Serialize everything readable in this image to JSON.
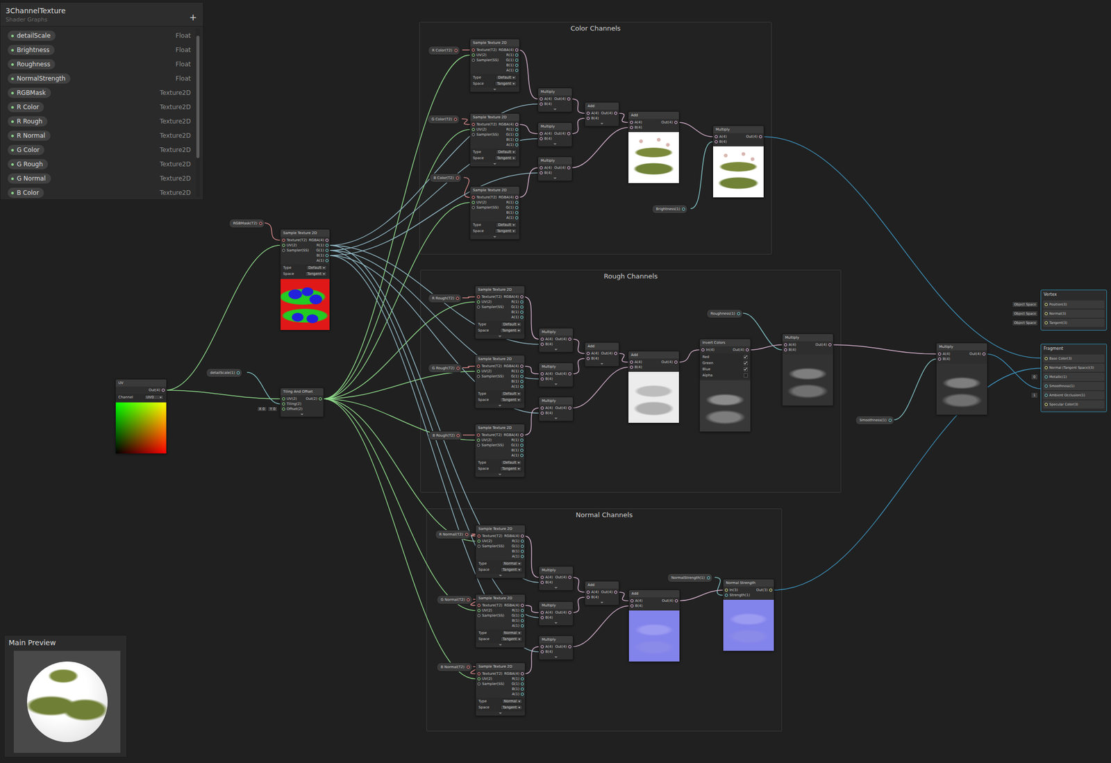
{
  "blackboard": {
    "title": "3ChannelTexture",
    "subtitle": "Shader Graphs",
    "add": "+",
    "properties": [
      {
        "name": "detailScale",
        "type": "Float"
      },
      {
        "name": "Brightness",
        "type": "Float"
      },
      {
        "name": "Roughness",
        "type": "Float"
      },
      {
        "name": "NormalStrength",
        "type": "Float"
      },
      {
        "name": "RGBMask",
        "type": "Texture2D"
      },
      {
        "name": "R Color",
        "type": "Texture2D"
      },
      {
        "name": "R Rough",
        "type": "Texture2D"
      },
      {
        "name": "R Normal",
        "type": "Texture2D"
      },
      {
        "name": "G Color",
        "type": "Texture2D"
      },
      {
        "name": "G Rough",
        "type": "Texture2D"
      },
      {
        "name": "G Normal",
        "type": "Texture2D"
      },
      {
        "name": "B Color",
        "type": "Texture2D"
      }
    ]
  },
  "main_preview": {
    "title": "Main Preview"
  },
  "groups": [
    {
      "title": "Color Channels"
    },
    {
      "title": "Rough Channels"
    },
    {
      "title": "Normal Channels"
    }
  ],
  "chips": [
    {
      "label": "RGBMask(T2)"
    },
    {
      "label": "detailScale(1)"
    },
    {
      "label": "R Color(T2)"
    },
    {
      "label": "G Color(T2)"
    },
    {
      "label": "B Color(T2)"
    },
    {
      "label": "Brightness(1)"
    },
    {
      "label": "R Rough(T2)"
    },
    {
      "label": "G Rough(T2)"
    },
    {
      "label": "B Rough(T2)"
    },
    {
      "label": "Roughness(1)"
    },
    {
      "label": "R Normal(T2)"
    },
    {
      "label": "G Normal(T2)"
    },
    {
      "label": "B Normal(T2)"
    },
    {
      "label": "NormalStrength(1)"
    },
    {
      "label": "Smoothness(1)"
    }
  ],
  "nodes": [
    {
      "title": "UV",
      "inputs": [],
      "outputs": [
        "Out(4)"
      ],
      "settings": [
        {
          "label": "Channel",
          "value": "UV0"
        }
      ],
      "preview": "uv"
    },
    {
      "title": "Sample Texture 2D",
      "inputs": [
        "Texture(T2)",
        "UV(2)",
        "Sampler(SS)"
      ],
      "outputs": [
        "RGBA(4)",
        "R(1)",
        "G(1)",
        "B(1)",
        "A(1)"
      ],
      "settings": [
        {
          "label": "Type",
          "value": "Default"
        },
        {
          "label": "Space",
          "value": "Tangent"
        }
      ],
      "preview": "mask"
    },
    {
      "title": "Tiling And Offset",
      "inputs": [
        "UV(2)",
        "Tiling(2)",
        "Offset(2)"
      ],
      "outputs": [
        "Out(2)"
      ],
      "fields": [
        {
          "axis": "X",
          "value": "0"
        },
        {
          "axis": "Y",
          "value": "0"
        }
      ],
      "preview": "none"
    },
    {
      "title": "Sample Texture 2D",
      "inputs": [
        "Texture(T2)",
        "UV(2)",
        "Sampler(SS)"
      ],
      "outputs": [
        "RGBA(4)",
        "R(1)",
        "G(1)",
        "B(1)",
        "A(1)"
      ],
      "settings": [
        {
          "label": "Type",
          "value": "Default"
        },
        {
          "label": "Space",
          "value": "Tangent"
        }
      ],
      "preview": "none"
    },
    {
      "title": "Sample Texture 2D",
      "inputs": [
        "Texture(T2)",
        "UV(2)",
        "Sampler(SS)"
      ],
      "outputs": [
        "RGBA(4)",
        "R(1)",
        "G(1)",
        "B(1)",
        "A(1)"
      ],
      "settings": [
        {
          "label": "Type",
          "value": "Default"
        },
        {
          "label": "Space",
          "value": "Tangent"
        }
      ],
      "preview": "none"
    },
    {
      "title": "Sample Texture 2D",
      "inputs": [
        "Texture(T2)",
        "UV(2)",
        "Sampler(SS)"
      ],
      "outputs": [
        "RGBA(4)",
        "R(1)",
        "G(1)",
        "B(1)",
        "A(1)"
      ],
      "settings": [
        {
          "label": "Type",
          "value": "Default"
        },
        {
          "label": "Space",
          "value": "Tangent"
        }
      ],
      "preview": "none"
    },
    {
      "title": "Multiply",
      "inputs": [
        "A(4)",
        "B(4)"
      ],
      "outputs": [
        "Out(4)"
      ],
      "preview": "none"
    },
    {
      "title": "Multiply",
      "inputs": [
        "A(4)",
        "B(4)"
      ],
      "outputs": [
        "Out(4)"
      ],
      "preview": "none"
    },
    {
      "title": "Multiply",
      "inputs": [
        "A(4)",
        "B(4)"
      ],
      "outputs": [
        "Out(4)"
      ],
      "preview": "none"
    },
    {
      "title": "Add",
      "inputs": [
        "A(4)",
        "B(4)"
      ],
      "outputs": [
        "Out(4)"
      ],
      "preview": "none"
    },
    {
      "title": "Add",
      "inputs": [
        "A(4)",
        "B(4)"
      ],
      "outputs": [
        "Out(4)"
      ],
      "preview": "color"
    },
    {
      "title": "Multiply",
      "inputs": [
        "A(4)",
        "B(4)"
      ],
      "outputs": [
        "Out(4)"
      ],
      "preview": "color"
    },
    {
      "title": "Sample Texture 2D",
      "inputs": [
        "Texture(T2)",
        "UV(2)",
        "Sampler(SS)"
      ],
      "outputs": [
        "RGBA(4)",
        "R(1)",
        "G(1)",
        "B(1)",
        "A(1)"
      ],
      "settings": [
        {
          "label": "Type",
          "value": "Default"
        },
        {
          "label": "Space",
          "value": "Tangent"
        }
      ],
      "preview": "none"
    },
    {
      "title": "Sample Texture 2D",
      "inputs": [
        "Texture(T2)",
        "UV(2)",
        "Sampler(SS)"
      ],
      "outputs": [
        "RGBA(4)",
        "R(1)",
        "G(1)",
        "B(1)",
        "A(1)"
      ],
      "settings": [
        {
          "label": "Type",
          "value": "Default"
        },
        {
          "label": "Space",
          "value": "Tangent"
        }
      ],
      "preview": "none"
    },
    {
      "title": "Sample Texture 2D",
      "inputs": [
        "Texture(T2)",
        "UV(2)",
        "Sampler(SS)"
      ],
      "outputs": [
        "RGBA(4)",
        "R(1)",
        "G(1)",
        "B(1)",
        "A(1)"
      ],
      "settings": [
        {
          "label": "Type",
          "value": "Default"
        },
        {
          "label": "Space",
          "value": "Tangent"
        }
      ],
      "preview": "none"
    },
    {
      "title": "Multiply",
      "inputs": [
        "A(4)",
        "B(4)"
      ],
      "outputs": [
        "Out(4)"
      ],
      "preview": "none"
    },
    {
      "title": "Multiply",
      "inputs": [
        "A(4)",
        "B(4)"
      ],
      "outputs": [
        "Out(4)"
      ],
      "preview": "none"
    },
    {
      "title": "Multiply",
      "inputs": [
        "A(4)",
        "B(4)"
      ],
      "outputs": [
        "Out(4)"
      ],
      "preview": "none"
    },
    {
      "title": "Add",
      "inputs": [
        "A(4)",
        "B(4)"
      ],
      "outputs": [
        "Out(4)"
      ],
      "preview": "none"
    },
    {
      "title": "Add",
      "inputs": [
        "A(4)",
        "B(4)"
      ],
      "outputs": [
        "Out(4)"
      ],
      "preview": "rough"
    },
    {
      "title": "Invert Colors",
      "inputs": [
        "In(4)"
      ],
      "outputs": [
        "Out(4)"
      ],
      "toggles": [
        {
          "label": "Red",
          "checked": true
        },
        {
          "label": "Green",
          "checked": true
        },
        {
          "label": "Blue",
          "checked": true
        },
        {
          "label": "Alpha",
          "checked": false
        }
      ],
      "preview": "invert"
    },
    {
      "title": "Multiply",
      "inputs": [
        "A(4)",
        "B(4)"
      ],
      "outputs": [
        "Out(4)"
      ],
      "preview": "dark"
    },
    {
      "title": "Sample Texture 2D",
      "inputs": [
        "Texture(T2)",
        "UV(2)",
        "Sampler(SS)"
      ],
      "outputs": [
        "RGBA(4)",
        "R(1)",
        "G(1)",
        "B(1)",
        "A(1)"
      ],
      "settings": [
        {
          "label": "Type",
          "value": "Normal"
        },
        {
          "label": "Space",
          "value": "Tangent"
        }
      ],
      "preview": "none"
    },
    {
      "title": "Sample Texture 2D",
      "inputs": [
        "Texture(T2)",
        "UV(2)",
        "Sampler(SS)"
      ],
      "outputs": [
        "RGBA(4)",
        "R(1)",
        "G(1)",
        "B(1)",
        "A(1)"
      ],
      "settings": [
        {
          "label": "Type",
          "value": "Normal"
        },
        {
          "label": "Space",
          "value": "Tangent"
        }
      ],
      "preview": "none"
    },
    {
      "title": "Sample Texture 2D",
      "inputs": [
        "Texture(T2)",
        "UV(2)",
        "Sampler(SS)"
      ],
      "outputs": [
        "RGBA(4)",
        "R(1)",
        "G(1)",
        "B(1)",
        "A(1)"
      ],
      "settings": [
        {
          "label": "Type",
          "value": "Normal"
        },
        {
          "label": "Space",
          "value": "Tangent"
        }
      ],
      "preview": "none"
    },
    {
      "title": "Multiply",
      "inputs": [
        "A(4)",
        "B(4)"
      ],
      "outputs": [
        "Out(4)"
      ],
      "preview": "none"
    },
    {
      "title": "Multiply",
      "inputs": [
        "A(4)",
        "B(4)"
      ],
      "outputs": [
        "Out(4)"
      ],
      "preview": "none"
    },
    {
      "title": "Multiply",
      "inputs": [
        "A(4)",
        "B(4)"
      ],
      "outputs": [
        "Out(4)"
      ],
      "preview": "none"
    },
    {
      "title": "Add",
      "inputs": [
        "A(4)",
        "B(4)"
      ],
      "outputs": [
        "Out(4)"
      ],
      "preview": "none"
    },
    {
      "title": "Add",
      "inputs": [
        "A(4)",
        "B(4)"
      ],
      "outputs": [
        "Out(4)"
      ],
      "preview": "normal"
    },
    {
      "title": "Normal Strength",
      "inputs": [
        "In(3)",
        "Strength(1)"
      ],
      "outputs": [
        "Out(3)"
      ],
      "preview": "normal"
    },
    {
      "title": "Multiply",
      "inputs": [
        "A(4)",
        "B(4)"
      ],
      "outputs": [
        "Out(4)"
      ],
      "preview": "dark"
    }
  ],
  "stacks": [
    {
      "title": "Vertex",
      "ports": [
        {
          "label": "Position(3)",
          "space": "Object Space",
          "value": ""
        },
        {
          "label": "Normal(3)",
          "space": "Object Space",
          "value": ""
        },
        {
          "label": "Tangent(3)",
          "space": "Object Space",
          "value": ""
        }
      ]
    },
    {
      "title": "Fragment",
      "ports": [
        {
          "label": "Base Color(3)",
          "space": "",
          "value": ""
        },
        {
          "label": "Normal (Tangent Space)(3)",
          "space": "",
          "value": ""
        },
        {
          "label": "Metallic(1)",
          "space": "",
          "value": "0"
        },
        {
          "label": "Smoothness(1)",
          "space": "",
          "value": ""
        },
        {
          "label": "Ambient Occlusion(1)",
          "space": "",
          "value": "1"
        },
        {
          "label": "Specular Color(3)",
          "space": "",
          "value": ""
        }
      ]
    }
  ]
}
